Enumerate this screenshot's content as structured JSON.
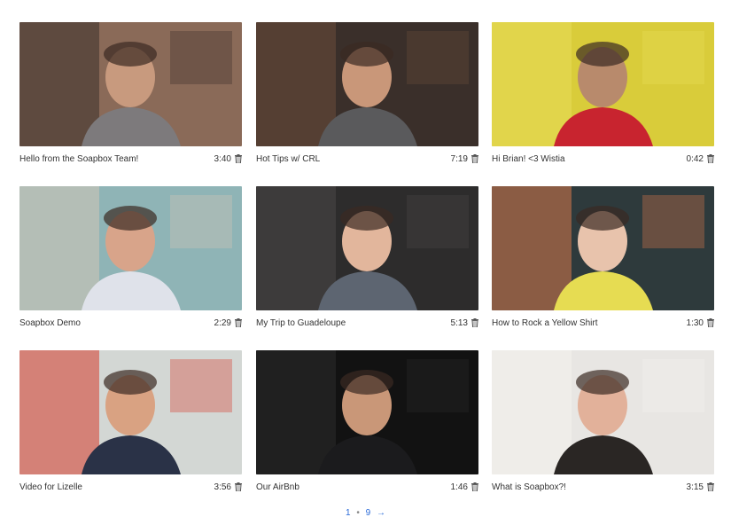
{
  "videos": [
    {
      "title": "Hello from the Soapbox Team!",
      "duration": "3:40",
      "colors": {
        "bg": "#8a6a58",
        "accent": "#3b2f2c",
        "skin": "#c89a7e",
        "shirt": "#7d7a7c"
      }
    },
    {
      "title": "Hot Tips w/ CRL",
      "duration": "7:19",
      "colors": {
        "bg": "#3a2f2a",
        "accent": "#6b4d3a",
        "skin": "#c99779",
        "shirt": "#5a5a5c"
      }
    },
    {
      "title": "Hi Brian! <3 Wistia",
      "duration": "0:42",
      "colors": {
        "bg": "#d9cc3a",
        "accent": "#e8dc5a",
        "skin": "#b88a6c",
        "shirt": "#c8242f"
      }
    },
    {
      "title": "Soapbox Demo",
      "duration": "2:29",
      "colors": {
        "bg": "#8fb4b6",
        "accent": "#d4c7b6",
        "skin": "#d8a48a",
        "shirt": "#dfe2ea"
      }
    },
    {
      "title": "My Trip to Guadeloupe",
      "duration": "5:13",
      "colors": {
        "bg": "#2d2c2c",
        "accent": "#4a4949",
        "skin": "#e2b69c",
        "shirt": "#5d6571"
      }
    },
    {
      "title": "How to Rock a Yellow Shirt",
      "duration": "1:30",
      "colors": {
        "bg": "#2e3a3c",
        "accent": "#d8784a",
        "skin": "#e8c3ac",
        "shirt": "#e6dc52"
      }
    },
    {
      "title": "Video for Lizelle",
      "duration": "3:56",
      "colors": {
        "bg": "#d3d7d4",
        "accent": "#d63a2a",
        "skin": "#d9a282",
        "shirt": "#2a3247"
      }
    },
    {
      "title": "Our AirBnb",
      "duration": "1:46",
      "colors": {
        "bg": "#121212",
        "accent": "#2b2b2b",
        "skin": "#c99778",
        "shirt": "#1b1b1d"
      }
    },
    {
      "title": "What is Soapbox?!",
      "duration": "3:15",
      "colors": {
        "bg": "#e8e6e3",
        "accent": "#f4f2ef",
        "skin": "#e2b19a",
        "shirt": "#2a2624"
      }
    }
  ],
  "pagination": {
    "current": "1",
    "separator": "•",
    "total": "9",
    "next": "→",
    "link_color": "#2a6ad8"
  },
  "icons": {
    "delete": "trash-icon"
  }
}
